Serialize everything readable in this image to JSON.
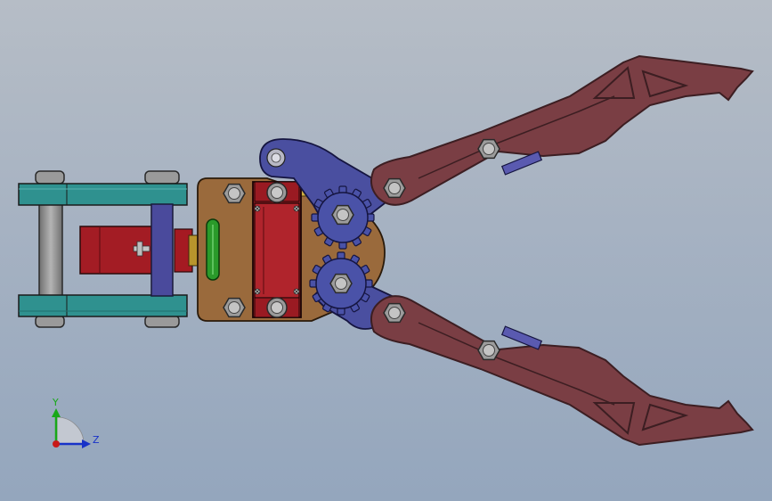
{
  "viewport": {
    "background_top": "#b6bdc6",
    "background_bottom": "#94a6bd"
  },
  "colors": {
    "jaw": "#7a3e44",
    "jaw_outline": "#3c1e22",
    "linkage": "#4a4fa0",
    "gear": "#4a52a8",
    "housing": "#9a6a3c",
    "servo": "#a61c24",
    "rail": "#2a8f8c",
    "bracket": "#4a4a9c",
    "rod": "#8a8a8a",
    "slot": "#2a9a2a",
    "bolt": "#a8a8a8"
  },
  "icons": {
    "triad": "axis-triad-icon",
    "bolt": "hex-bolt-icon",
    "gear": "spur-gear-icon"
  },
  "triad": {
    "y_label": "Y",
    "z_label": "Z",
    "y_color": "#18a818",
    "z_color": "#1832c8",
    "origin_color": "#c81818"
  }
}
